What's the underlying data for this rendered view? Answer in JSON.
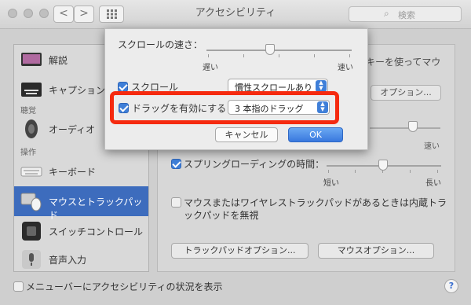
{
  "window": {
    "title": "アクセシビリティ"
  },
  "toolbar": {
    "back": "<",
    "forward": ">",
    "search_placeholder": "検索"
  },
  "sidebar": {
    "items": [
      {
        "label": "解説"
      },
      {
        "label": "キャプション"
      },
      {
        "label": "オーディオ"
      },
      {
        "label": "キーボード"
      },
      {
        "label": "マウスとトラックパッド"
      },
      {
        "label": "スイッチコントロール"
      },
      {
        "label": "音声入力"
      }
    ],
    "headers": {
      "hearing": "聴覚",
      "interaction": "操作"
    }
  },
  "panel": {
    "partial_text": "キーを使ってマウ",
    "options_button": "オプション...",
    "slider2_fast": "速い",
    "spring_loading": {
      "label": "スプリングローディングの時間：",
      "checked": true,
      "short": "短い",
      "long": "長い"
    },
    "ignore_builtin": {
      "label_line1": "マウスまたはワイヤレストラックパッドがあるときは内蔵トラ",
      "label_line2": "ックパッドを無視",
      "checked": false
    },
    "trackpad_options_button": "トラックパッドオプション...",
    "mouse_options_button": "マウスオプション..."
  },
  "sheet": {
    "scroll_speed_label": "スクロールの速さ：",
    "slow": "遅い",
    "fast": "速い",
    "scroll": {
      "label": "スクロール",
      "checked": true,
      "option": "慣性スクロールあり"
    },
    "drag": {
      "label": "ドラッグを有効にする",
      "checked": true,
      "option": "3 本指のドラッグ"
    },
    "cancel_button": "キャンセル",
    "ok_button": "OK"
  },
  "footer": {
    "menubar_status_label": "メニューバーにアクセシビリティの状況を表示",
    "checked": false,
    "help": "?"
  },
  "colors": {
    "accent": "#3f7fd8",
    "selection": "#3d6cbd",
    "highlight": "#f52a0f"
  }
}
